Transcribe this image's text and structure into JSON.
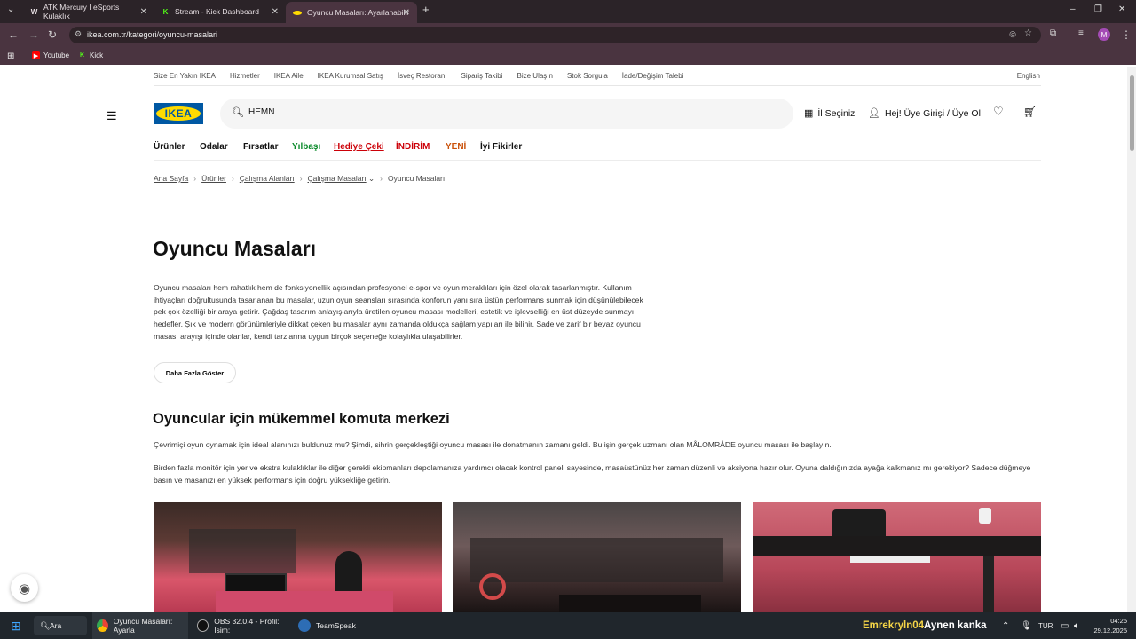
{
  "browser": {
    "tabs": [
      {
        "title": "ATK Mercury I eSports Kulaklık",
        "favicon": "W"
      },
      {
        "title": "Stream - Kick Dashboard",
        "favicon": "K"
      },
      {
        "title": "Oyuncu Masaları: Ayarlanabilir",
        "favicon": "ikea"
      }
    ],
    "url": "ikea.com.tr/kategori/oyuncu-masalari",
    "bookmarks": [
      {
        "label": "Youtube"
      },
      {
        "label": "Kick"
      }
    ],
    "profile_initial": "M"
  },
  "site": {
    "top_links": [
      "Size En Yakın IKEA",
      "Hizmetler",
      "IKEA Aile",
      "IKEA Kurumsal Satış",
      "İsveç Restoranı",
      "Sipariş Takibi",
      "Bize Ulaşın",
      "Stok Sorgula",
      "İade/Değişim Talebi"
    ],
    "language_link": "English",
    "logo_text": "IKEA",
    "search_value": "HEMN",
    "header_actions": {
      "store": "İl Seçiniz",
      "account": "Hej! Üye Girişi / Üye Ol"
    },
    "menu": [
      {
        "label": "Ürünler",
        "color": "#111111"
      },
      {
        "label": "Odalar",
        "color": "#111111"
      },
      {
        "label": "Fırsatlar",
        "color": "#111111"
      },
      {
        "label": "Yılbaşı",
        "color": "#0a8a2a"
      },
      {
        "label": "Hediye Çeki",
        "color": "#cc0008"
      },
      {
        "label": "İNDİRİM",
        "color": "#cc0008"
      },
      {
        "label": "YENİ",
        "color": "#ca5008"
      },
      {
        "label": "İyi Fikirler",
        "color": "#111111"
      }
    ],
    "breadcrumb": [
      "Ana Sayfa",
      "Ürünler",
      "Çalışma Alanları",
      "Çalışma Masaları",
      "Oyuncu Masaları"
    ]
  },
  "content": {
    "title": "Oyuncu Masaları",
    "intro": "Oyuncu masaları hem rahatlık hem de fonksiyonellik açısından profesyonel e-spor ve oyun meraklıları için özel olarak tasarlanmıştır. Kullanım ihtiyaçları doğrultusunda tasarlanan bu masalar, uzun oyun seansları sırasında konforun yanı sıra üstün performans sunmak için düşünülebilecek pek çok özelliği bir araya getirir. Çağdaş tasarım anlayışlarıyla üretilen oyuncu masası modelleri, estetik ve işlevselliği en üst düzeyde sunmayı hedefler. Şık ve modern görünümleriyle dikkat çeken bu masalar aynı zamanda oldukça sağlam yapıları ile bilinir. Sade ve zarif bir beyaz oyuncu masası arayışı içinde olanlar, kendi tarzlarına uygun birçok seçeneğe kolaylıkla ulaşabilirler.",
    "more_button": "Daha Fazla Göster",
    "section_title": "Oyuncular için mükemmel komuta merkezi",
    "paragraph1": "Çevrimiçi oyun oynamak için ideal alanınızı buldunuz mu? Şimdi, sihrin gerçekleştiği oyuncu masası ile donatmanın zamanı geldi. Bu işin gerçek uzmanı olan MÅLOMRÅDE oyuncu masası ile başlayın.",
    "paragraph2": "Birden fazla monitör için yer ve ekstra kulaklıklar ile diğer gerekli ekipmanları depolamanıza yardımcı olacak kontrol paneli sayesinde, masaüstünüz her zaman düzenli ve aksiyona hazır olur. Oyuna daldığınızda ayağa kalkmanız mı gerekiyor? Sadece düğmeye basın ve masanızı en yüksek performans için doğru yüksekliğe getirin."
  },
  "taskbar": {
    "search_label": "Ara",
    "apps": [
      {
        "label": "Oyuncu Masaları: Ayarla"
      },
      {
        "label": "OBS 32.0.4 - Profil: İsim:"
      },
      {
        "label": "TeamSpeak"
      }
    ],
    "stream_user": "Emrekryln04",
    "stream_message": "Aynen kanka",
    "language": "TUR",
    "time": "04:25",
    "date": "29.12.2025"
  }
}
